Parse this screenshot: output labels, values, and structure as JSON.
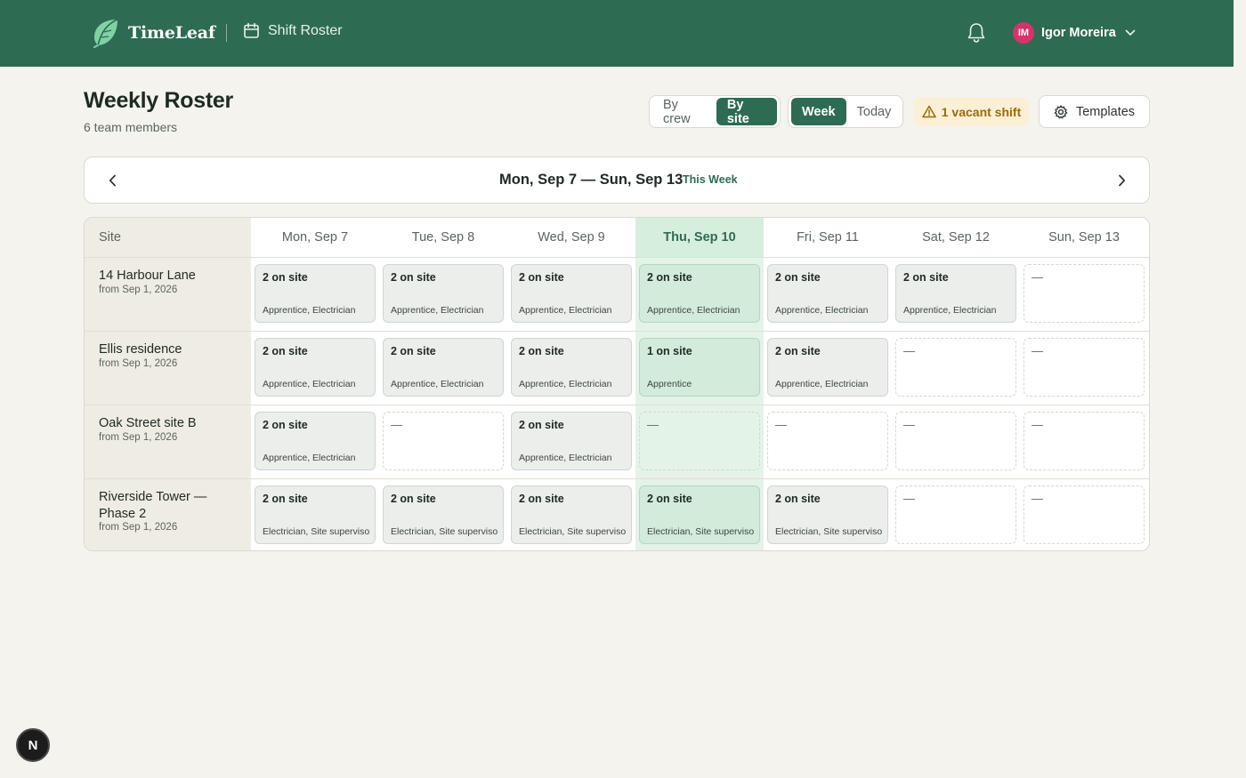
{
  "app": {
    "name": "TimeLeaf",
    "page": "Shift Roster"
  },
  "user": {
    "name": "Igor Moreira",
    "initials": "IM"
  },
  "header": {
    "title": "Weekly Roster",
    "subtitle": "6 team members"
  },
  "view_toggle": {
    "by_crew": "By crew",
    "by_site": "By site",
    "selected": "By site"
  },
  "range_toggle": {
    "week": "Week",
    "today": "Today",
    "selected": "Week"
  },
  "alerts": {
    "vacant": "1 vacant shift"
  },
  "templates": {
    "label": "Templates"
  },
  "week_nav": {
    "range": "Mon, Sep 7 — Sun, Sep 13",
    "this_week": "This Week"
  },
  "grid": {
    "site_header": "Site",
    "days": [
      "Mon, Sep 7",
      "Tue, Sep 8",
      "Wed, Sep 9",
      "Thu, Sep 10",
      "Fri, Sep 11",
      "Sat, Sep 12",
      "Sun, Sep 13"
    ],
    "today_index": 3,
    "sites": [
      {
        "name": "14 Harbour Lane",
        "from": "from Sep 1, 2026",
        "cells": [
          {
            "count": "2 on site",
            "roles": "Apprentice, Electrician"
          },
          {
            "count": "2 on site",
            "roles": "Apprentice, Electrician"
          },
          {
            "count": "2 on site",
            "roles": "Apprentice, Electrician"
          },
          {
            "count": "2 on site",
            "roles": "Apprentice, Electrician"
          },
          {
            "count": "2 on site",
            "roles": "Apprentice, Electrician"
          },
          {
            "count": "2 on site",
            "roles": "Apprentice, Electrician"
          },
          {
            "empty": "—"
          }
        ]
      },
      {
        "name": "Ellis residence",
        "from": "from Sep 1, 2026",
        "cells": [
          {
            "count": "2 on site",
            "roles": "Apprentice, Electrician"
          },
          {
            "count": "2 on site",
            "roles": "Apprentice, Electrician"
          },
          {
            "count": "2 on site",
            "roles": "Apprentice, Electrician"
          },
          {
            "count": "1 on site",
            "roles": "Apprentice"
          },
          {
            "count": "2 on site",
            "roles": "Apprentice, Electrician"
          },
          {
            "empty": "—"
          },
          {
            "empty": "—"
          }
        ]
      },
      {
        "name": "Oak Street site B",
        "from": "from Sep 1, 2026",
        "cells": [
          {
            "count": "2 on site",
            "roles": "Apprentice, Electrician"
          },
          {
            "empty": "—"
          },
          {
            "count": "2 on site",
            "roles": "Apprentice, Electrician"
          },
          {
            "empty": "—"
          },
          {
            "empty": "—"
          },
          {
            "empty": "—"
          },
          {
            "empty": "—"
          }
        ]
      },
      {
        "name": "Riverside Tower — Phase 2",
        "from": "from Sep 1, 2026",
        "cells": [
          {
            "count": "2 on site",
            "roles": "Electrician, Site superviso"
          },
          {
            "count": "2 on site",
            "roles": "Electrician, Site superviso"
          },
          {
            "count": "2 on site",
            "roles": "Electrician, Site superviso"
          },
          {
            "count": "2 on site",
            "roles": "Electrician, Site superviso"
          },
          {
            "count": "2 on site",
            "roles": "Electrician, Site superviso"
          },
          {
            "empty": "—"
          },
          {
            "empty": "—"
          }
        ]
      }
    ]
  },
  "fab": {
    "label": "N"
  },
  "colors": {
    "brand": "#2e6b53",
    "today": "#e4f3e8",
    "warning": "#9a6b09",
    "avatar": "#d6336c"
  },
  "icons": {
    "logo": "leaf-logo-icon",
    "calendar": "calendar-icon",
    "bell": "bell-icon",
    "chevron": "chevron-down-icon",
    "warning": "warning-icon",
    "gear": "gear-icon",
    "prev": "chevron-left-icon",
    "next": "chevron-right-icon"
  }
}
